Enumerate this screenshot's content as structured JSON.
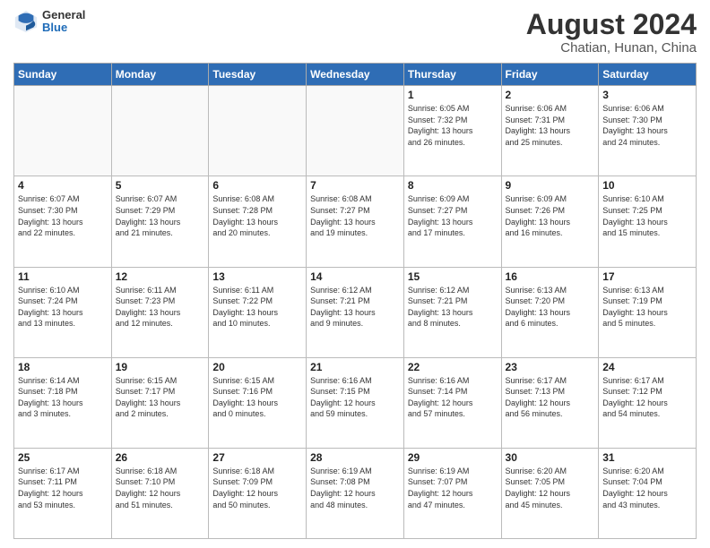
{
  "header": {
    "logo_general": "General",
    "logo_blue": "Blue",
    "title": "August 2024",
    "subtitle": "Chatian, Hunan, China"
  },
  "weekdays": [
    "Sunday",
    "Monday",
    "Tuesday",
    "Wednesday",
    "Thursday",
    "Friday",
    "Saturday"
  ],
  "weeks": [
    [
      {
        "day": "",
        "info": ""
      },
      {
        "day": "",
        "info": ""
      },
      {
        "day": "",
        "info": ""
      },
      {
        "day": "",
        "info": ""
      },
      {
        "day": "1",
        "info": "Sunrise: 6:05 AM\nSunset: 7:32 PM\nDaylight: 13 hours\nand 26 minutes."
      },
      {
        "day": "2",
        "info": "Sunrise: 6:06 AM\nSunset: 7:31 PM\nDaylight: 13 hours\nand 25 minutes."
      },
      {
        "day": "3",
        "info": "Sunrise: 6:06 AM\nSunset: 7:30 PM\nDaylight: 13 hours\nand 24 minutes."
      }
    ],
    [
      {
        "day": "4",
        "info": "Sunrise: 6:07 AM\nSunset: 7:30 PM\nDaylight: 13 hours\nand 22 minutes."
      },
      {
        "day": "5",
        "info": "Sunrise: 6:07 AM\nSunset: 7:29 PM\nDaylight: 13 hours\nand 21 minutes."
      },
      {
        "day": "6",
        "info": "Sunrise: 6:08 AM\nSunset: 7:28 PM\nDaylight: 13 hours\nand 20 minutes."
      },
      {
        "day": "7",
        "info": "Sunrise: 6:08 AM\nSunset: 7:27 PM\nDaylight: 13 hours\nand 19 minutes."
      },
      {
        "day": "8",
        "info": "Sunrise: 6:09 AM\nSunset: 7:27 PM\nDaylight: 13 hours\nand 17 minutes."
      },
      {
        "day": "9",
        "info": "Sunrise: 6:09 AM\nSunset: 7:26 PM\nDaylight: 13 hours\nand 16 minutes."
      },
      {
        "day": "10",
        "info": "Sunrise: 6:10 AM\nSunset: 7:25 PM\nDaylight: 13 hours\nand 15 minutes."
      }
    ],
    [
      {
        "day": "11",
        "info": "Sunrise: 6:10 AM\nSunset: 7:24 PM\nDaylight: 13 hours\nand 13 minutes."
      },
      {
        "day": "12",
        "info": "Sunrise: 6:11 AM\nSunset: 7:23 PM\nDaylight: 13 hours\nand 12 minutes."
      },
      {
        "day": "13",
        "info": "Sunrise: 6:11 AM\nSunset: 7:22 PM\nDaylight: 13 hours\nand 10 minutes."
      },
      {
        "day": "14",
        "info": "Sunrise: 6:12 AM\nSunset: 7:21 PM\nDaylight: 13 hours\nand 9 minutes."
      },
      {
        "day": "15",
        "info": "Sunrise: 6:12 AM\nSunset: 7:21 PM\nDaylight: 13 hours\nand 8 minutes."
      },
      {
        "day": "16",
        "info": "Sunrise: 6:13 AM\nSunset: 7:20 PM\nDaylight: 13 hours\nand 6 minutes."
      },
      {
        "day": "17",
        "info": "Sunrise: 6:13 AM\nSunset: 7:19 PM\nDaylight: 13 hours\nand 5 minutes."
      }
    ],
    [
      {
        "day": "18",
        "info": "Sunrise: 6:14 AM\nSunset: 7:18 PM\nDaylight: 13 hours\nand 3 minutes."
      },
      {
        "day": "19",
        "info": "Sunrise: 6:15 AM\nSunset: 7:17 PM\nDaylight: 13 hours\nand 2 minutes."
      },
      {
        "day": "20",
        "info": "Sunrise: 6:15 AM\nSunset: 7:16 PM\nDaylight: 13 hours\nand 0 minutes."
      },
      {
        "day": "21",
        "info": "Sunrise: 6:16 AM\nSunset: 7:15 PM\nDaylight: 12 hours\nand 59 minutes."
      },
      {
        "day": "22",
        "info": "Sunrise: 6:16 AM\nSunset: 7:14 PM\nDaylight: 12 hours\nand 57 minutes."
      },
      {
        "day": "23",
        "info": "Sunrise: 6:17 AM\nSunset: 7:13 PM\nDaylight: 12 hours\nand 56 minutes."
      },
      {
        "day": "24",
        "info": "Sunrise: 6:17 AM\nSunset: 7:12 PM\nDaylight: 12 hours\nand 54 minutes."
      }
    ],
    [
      {
        "day": "25",
        "info": "Sunrise: 6:17 AM\nSunset: 7:11 PM\nDaylight: 12 hours\nand 53 minutes."
      },
      {
        "day": "26",
        "info": "Sunrise: 6:18 AM\nSunset: 7:10 PM\nDaylight: 12 hours\nand 51 minutes."
      },
      {
        "day": "27",
        "info": "Sunrise: 6:18 AM\nSunset: 7:09 PM\nDaylight: 12 hours\nand 50 minutes."
      },
      {
        "day": "28",
        "info": "Sunrise: 6:19 AM\nSunset: 7:08 PM\nDaylight: 12 hours\nand 48 minutes."
      },
      {
        "day": "29",
        "info": "Sunrise: 6:19 AM\nSunset: 7:07 PM\nDaylight: 12 hours\nand 47 minutes."
      },
      {
        "day": "30",
        "info": "Sunrise: 6:20 AM\nSunset: 7:05 PM\nDaylight: 12 hours\nand 45 minutes."
      },
      {
        "day": "31",
        "info": "Sunrise: 6:20 AM\nSunset: 7:04 PM\nDaylight: 12 hours\nand 43 minutes."
      }
    ]
  ]
}
